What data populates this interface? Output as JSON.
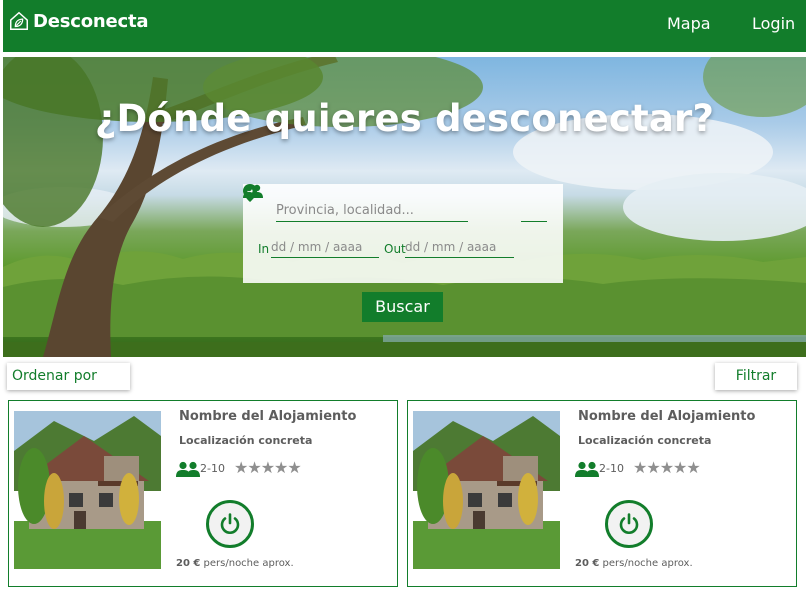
{
  "navbar": {
    "brand": "Desconecta",
    "links": {
      "mapa": "Mapa",
      "login": "Login"
    },
    "color": "#127d2b"
  },
  "hero": {
    "title": "¿Dónde quieres desconectar?",
    "search": {
      "place_placeholder": "Provincia, localidad...",
      "in_label": "In",
      "in_placeholder": "dd / mm / aaaa",
      "out_label": "Out",
      "out_placeholder": "dd / mm / aaaa",
      "button": "Buscar"
    }
  },
  "controls": {
    "sort": "Ordenar por",
    "filter": "Filtrar"
  },
  "cards": [
    {
      "name": "Nombre del Alojamiento",
      "location": "Localización concreta",
      "guests": "2-10",
      "stars": "★★★★★",
      "price_value": "20 €",
      "price_suffix": " pers/noche aprox."
    },
    {
      "name": "Nombre del Alojamiento",
      "location": "Localización concreta",
      "guests": "2-10",
      "stars": "★★★★★",
      "price_value": "20 €",
      "price_suffix": " pers/noche aprox."
    }
  ],
  "icons": {
    "brand": "house-leaf-icon",
    "place": "location-pin-icon",
    "guests": "people-icon",
    "power": "power-icon"
  }
}
